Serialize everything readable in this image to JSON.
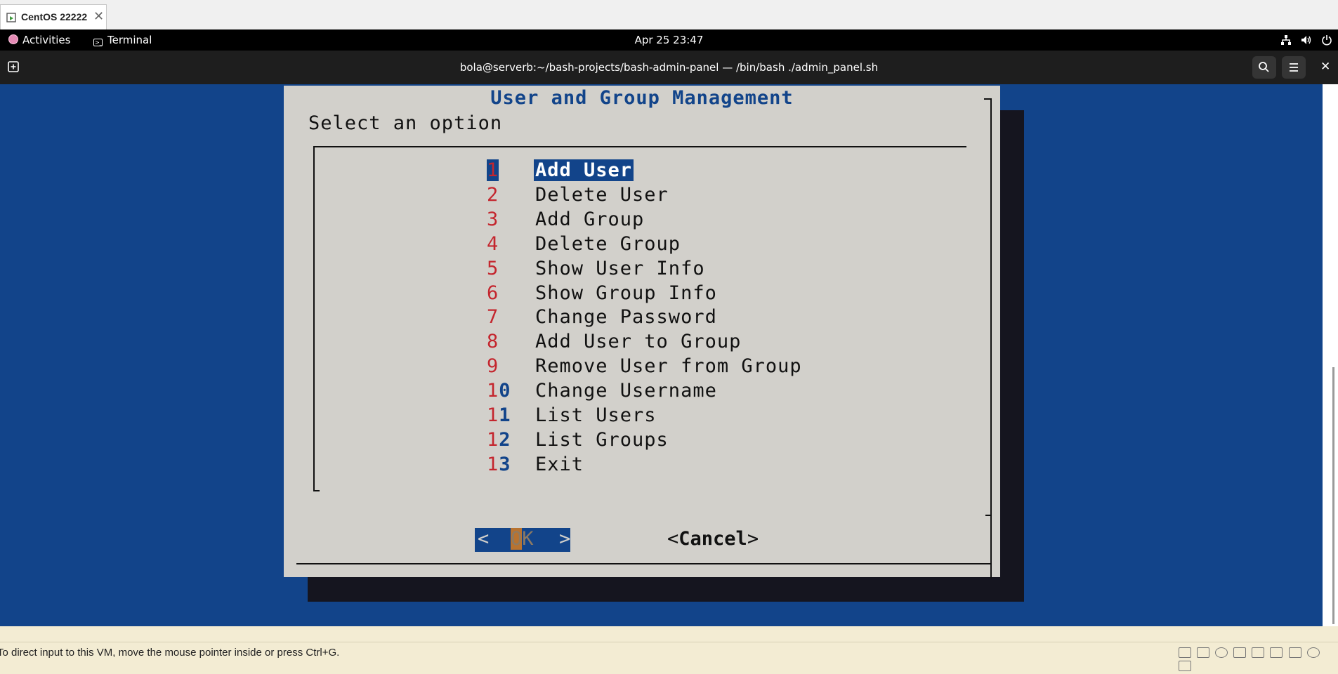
{
  "vm_tab": {
    "title": "CentOS 22222",
    "close_glyph": "✕"
  },
  "gnome_bar": {
    "activities": "Activities",
    "app_name": "Terminal",
    "clock": "Apr 25  23:47"
  },
  "terminal": {
    "title": "bola@serverb:~/bash-projects/bash-admin-panel — /bin/bash ./admin_panel.sh",
    "close_glyph": "✕"
  },
  "dialog": {
    "title": "User and Group Management",
    "prompt": "Select an option",
    "selected_index": 0,
    "items": [
      {
        "tag_hot": "1",
        "tag_rest": "",
        "label": "Add User"
      },
      {
        "tag_hot": "2",
        "tag_rest": "",
        "label": "Delete User"
      },
      {
        "tag_hot": "3",
        "tag_rest": "",
        "label": "Add Group"
      },
      {
        "tag_hot": "4",
        "tag_rest": "",
        "label": "Delete Group"
      },
      {
        "tag_hot": "5",
        "tag_rest": "",
        "label": "Show User Info"
      },
      {
        "tag_hot": "6",
        "tag_rest": "",
        "label": "Show Group Info"
      },
      {
        "tag_hot": "7",
        "tag_rest": "",
        "label": "Change Password"
      },
      {
        "tag_hot": "8",
        "tag_rest": "",
        "label": "Add User to Group"
      },
      {
        "tag_hot": "9",
        "tag_rest": "",
        "label": "Remove User from Group"
      },
      {
        "tag_hot": "1",
        "tag_rest": "0",
        "label": "Change Username"
      },
      {
        "tag_hot": "1",
        "tag_rest": "1",
        "label": "List Users"
      },
      {
        "tag_hot": "1",
        "tag_rest": "2",
        "label": "List Groups"
      },
      {
        "tag_hot": "1",
        "tag_rest": "3",
        "label": "Exit"
      }
    ],
    "ok_button": {
      "left": "<",
      "hot": "O",
      "rest": "K",
      "right": ">"
    },
    "cancel_button": {
      "left": "<",
      "label": "Cancel",
      "right": ">"
    }
  },
  "status_bar": {
    "message": "To direct input to this VM, move the mouse pointer inside or press Ctrl+G."
  },
  "colors": {
    "terminal_bg": "#12448a",
    "dialog_bg": "#d2d0cb",
    "hotkey_red": "#c4262e",
    "selection": "#12448a"
  }
}
